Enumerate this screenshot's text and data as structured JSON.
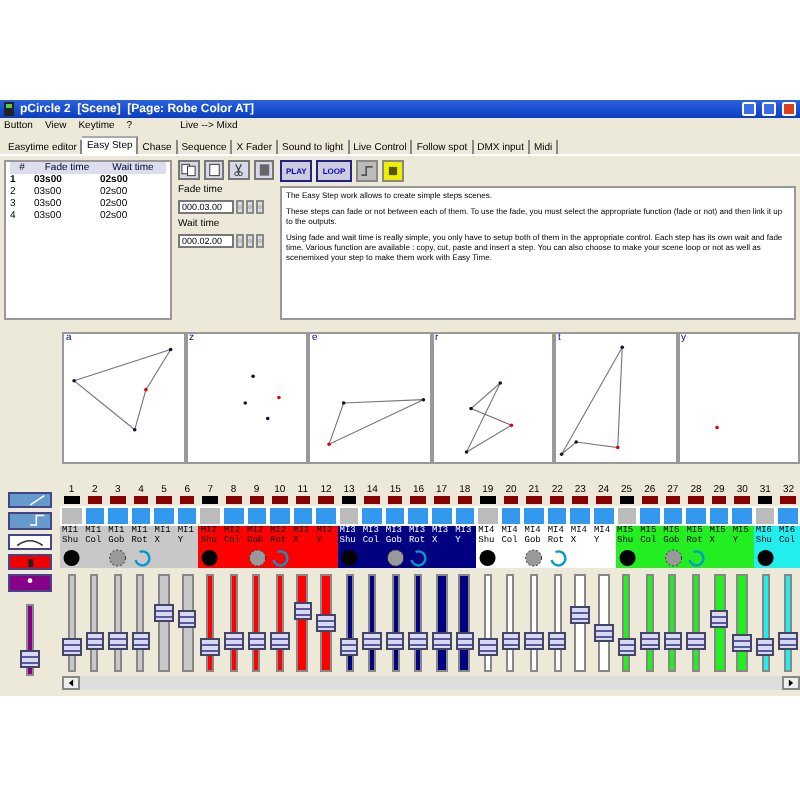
{
  "window": {
    "title": "pCircle 2  [Scene]  [Page: Robe Color AT]"
  },
  "menu": [
    {
      "label": "Button"
    },
    {
      "label": "View"
    },
    {
      "label": "Keytime"
    },
    {
      "label": "?"
    },
    {
      "label": "Live --> Mixd"
    }
  ],
  "tabs": [
    {
      "label": "Easytime editor",
      "selected": false
    },
    {
      "label": "Easy Step",
      "selected": true
    },
    {
      "label": "Chase",
      "selected": false
    },
    {
      "label": "Sequence",
      "selected": false
    },
    {
      "label": "X Fader",
      "selected": false
    },
    {
      "label": "Sound to light",
      "selected": false
    },
    {
      "label": "Live Control",
      "selected": false
    },
    {
      "label": "Follow spot",
      "selected": false
    },
    {
      "label": "DMX input",
      "selected": false
    },
    {
      "label": "Midi",
      "selected": false
    }
  ],
  "steps": {
    "columns": [
      "#",
      "Fade time",
      "Wait time"
    ],
    "rows": [
      {
        "cells": [
          "1",
          "03s00",
          "02s00"
        ],
        "selected": true
      },
      {
        "cells": [
          "2",
          "03s00",
          "02s00"
        ],
        "selected": false
      },
      {
        "cells": [
          "3",
          "03s00",
          "02s00"
        ],
        "selected": false
      },
      {
        "cells": [
          "4",
          "03s00",
          "02s00"
        ],
        "selected": false
      }
    ]
  },
  "fade_time": {
    "label": "Fade time",
    "value": "000.03.00"
  },
  "wait_time": {
    "label": "Wait time",
    "value": "000.02.00"
  },
  "play_buttons": [
    {
      "label": "PLAY"
    },
    {
      "label": "LOOP"
    }
  ],
  "description": [
    "The Easy Step work allows to create simple steps scenes.",
    "These steps can fade or not between each of them. To use the fade, you must select the appropriate function (fade or not) and then link it up to the outputs.",
    "Using fade and wait time is really simple, you only have to setup both of them in the appropriate control. Each step has its own wait and fade time. Various function are available : copy, cut, paste and insert a step. You can also choose to make your scene loop or not as well as scenemixed your step to make them work with Easy Time."
  ],
  "graphs": [
    {
      "label": "a"
    },
    {
      "label": "z"
    },
    {
      "label": "e"
    },
    {
      "label": "r"
    },
    {
      "label": "t"
    },
    {
      "label": "y"
    }
  ],
  "master": {
    "level": 0.15
  },
  "channels": [
    {
      "number": "1",
      "kind": "shutter",
      "group": "MI1",
      "param": "Shu",
      "color": "#c8c8c8",
      "level": 0.2
    },
    {
      "number": "2",
      "kind": "color",
      "group": "MI1",
      "param": "Col",
      "color": "#c8c8c8",
      "level": 0.27
    },
    {
      "number": "3",
      "kind": "gobo",
      "group": "MI1",
      "param": "Gob",
      "color": "#c8c8c8",
      "level": 0.27
    },
    {
      "number": "4",
      "kind": "rotation",
      "group": "MI1",
      "param": "Rot",
      "color": "#c8c8c8",
      "level": 0.27
    },
    {
      "number": "5",
      "kind": "pan",
      "group": "MI1",
      "param": "X",
      "color": "#c8c8c8",
      "level": 0.62
    },
    {
      "number": "6",
      "kind": "tilt",
      "group": "MI1",
      "param": "Y",
      "color": "#c8c8c8",
      "level": 0.55
    },
    {
      "number": "7",
      "kind": "shutter",
      "group": "MI2",
      "param": "Shu",
      "color": "#ff0000",
      "level": 0.2
    },
    {
      "number": "8",
      "kind": "color",
      "group": "MI2",
      "param": "Col",
      "color": "#ff0000",
      "level": 0.27
    },
    {
      "number": "9",
      "kind": "gobo",
      "group": "MI2",
      "param": "Gob",
      "color": "#ff0000",
      "level": 0.27
    },
    {
      "number": "10",
      "kind": "rotation",
      "group": "MI2",
      "param": "Rot",
      "color": "#ff0000",
      "level": 0.27
    },
    {
      "number": "11",
      "kind": "pan",
      "group": "MI2",
      "param": "X",
      "color": "#ff0000",
      "level": 0.65
    },
    {
      "number": "12",
      "kind": "tilt",
      "group": "MI2",
      "param": "Y",
      "color": "#ff0000",
      "level": 0.5
    },
    {
      "number": "13",
      "kind": "shutter",
      "group": "MI3",
      "param": "Shu",
      "color": "#000080",
      "level": 0.2
    },
    {
      "number": "14",
      "kind": "color",
      "group": "MI3",
      "param": "Col",
      "color": "#000080",
      "level": 0.27
    },
    {
      "number": "15",
      "kind": "gobo",
      "group": "MI3",
      "param": "Gob",
      "color": "#000080",
      "level": 0.27
    },
    {
      "number": "16",
      "kind": "rotation",
      "group": "MI3",
      "param": "Rot",
      "color": "#000080",
      "level": 0.27
    },
    {
      "number": "17",
      "kind": "pan",
      "group": "MI3",
      "param": "X",
      "color": "#000080",
      "level": 0.27
    },
    {
      "number": "18",
      "kind": "tilt",
      "group": "MI3",
      "param": "Y",
      "color": "#000080",
      "level": 0.27
    },
    {
      "number": "19",
      "kind": "shutter",
      "group": "MI4",
      "param": "Shu",
      "color": "#ffffff",
      "level": 0.2
    },
    {
      "number": "20",
      "kind": "color",
      "group": "MI4",
      "param": "Col",
      "color": "#ffffff",
      "level": 0.27
    },
    {
      "number": "21",
      "kind": "gobo",
      "group": "MI4",
      "param": "Gob",
      "color": "#ffffff",
      "level": 0.27
    },
    {
      "number": "22",
      "kind": "rotation",
      "group": "MI4",
      "param": "Rot",
      "color": "#ffffff",
      "level": 0.27
    },
    {
      "number": "23",
      "kind": "pan",
      "group": "MI4",
      "param": "X",
      "color": "#ffffff",
      "level": 0.6
    },
    {
      "number": "24",
      "kind": "tilt",
      "group": "MI4",
      "param": "Y",
      "color": "#ffffff",
      "level": 0.38
    },
    {
      "number": "25",
      "kind": "shutter",
      "group": "MI5",
      "param": "Shu",
      "color": "#22ee22",
      "level": 0.2
    },
    {
      "number": "26",
      "kind": "color",
      "group": "MI5",
      "param": "Col",
      "color": "#22ee22",
      "level": 0.27
    },
    {
      "number": "27",
      "kind": "gobo",
      "group": "MI5",
      "param": "Gob",
      "color": "#22ee22",
      "level": 0.27
    },
    {
      "number": "28",
      "kind": "rotation",
      "group": "MI5",
      "param": "Rot",
      "color": "#22ee22",
      "level": 0.27
    },
    {
      "number": "29",
      "kind": "pan",
      "group": "MI5",
      "param": "X",
      "color": "#22ee22",
      "level": 0.55
    },
    {
      "number": "30",
      "kind": "tilt",
      "group": "MI5",
      "param": "Y",
      "color": "#22ee22",
      "level": 0.24
    },
    {
      "number": "31",
      "kind": "shutter",
      "group": "MI6",
      "param": "Shu",
      "color": "#22eeee",
      "level": 0.2
    },
    {
      "number": "32",
      "kind": "color",
      "group": "MI6",
      "param": "Col",
      "color": "#22eeee",
      "level": 0.27
    }
  ]
}
